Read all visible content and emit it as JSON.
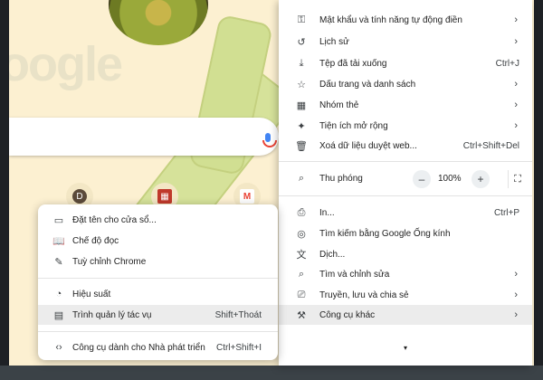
{
  "background": {
    "logo_text": "oogle",
    "shortcuts": [
      "D",
      "▦",
      "M"
    ]
  },
  "menu": {
    "items": [
      {
        "icon": "key-icon",
        "glyph": "⚿",
        "label": "Mật khẩu và tính năng tự động điền",
        "chevron": "›"
      },
      {
        "icon": "history-icon",
        "glyph": "↺",
        "label": "Lịch sử",
        "chevron": "›"
      },
      {
        "icon": "download-icon",
        "glyph": "⤓",
        "label": "Tệp đã tải xuống",
        "shortcut": "Ctrl+J"
      },
      {
        "icon": "star-icon",
        "glyph": "☆",
        "label": "Dấu trang và danh sách",
        "chevron": "›"
      },
      {
        "icon": "tab-groups-icon",
        "glyph": "▦",
        "label": "Nhóm thẻ",
        "chevron": "›"
      },
      {
        "icon": "extensions-icon",
        "glyph": "✦",
        "label": "Tiện ích mở rộng",
        "chevron": "›"
      },
      {
        "icon": "trash-icon",
        "glyph": "🗑",
        "label": "Xoá dữ liệu duyệt web...",
        "shortcut": "Ctrl+Shift+Del"
      }
    ],
    "zoom": {
      "icon": "zoom-icon",
      "glyph": "⌕",
      "label": "Thu phóng",
      "minus": "–",
      "value": "100%",
      "plus": "+",
      "fullscreen": "⛶"
    },
    "items2": [
      {
        "icon": "print-icon",
        "glyph": "⎙",
        "label": "In...",
        "shortcut": "Ctrl+P"
      },
      {
        "icon": "google-lens-icon",
        "glyph": "◎",
        "label": "Tìm kiếm bằng Google Ống kính"
      },
      {
        "icon": "translate-icon",
        "glyph": "文",
        "label": "Dịch..."
      },
      {
        "icon": "find-edit-icon",
        "glyph": "⌕",
        "label": "Tìm và chỉnh sửa",
        "chevron": "›"
      },
      {
        "icon": "cast-icon",
        "glyph": "⎚",
        "label": "Truyền, lưu và chia sẻ",
        "chevron": "›"
      },
      {
        "icon": "toolbox-icon",
        "glyph": "⚒",
        "label": "Công cụ khác",
        "chevron": "›"
      }
    ],
    "more_arrow": "▾"
  },
  "submenu": {
    "items": [
      {
        "icon": "window-name-icon",
        "glyph": "▭",
        "label": "Đặt tên cho cửa sổ..."
      },
      {
        "icon": "reading-mode-icon",
        "glyph": "📖",
        "label": "Chế độ đọc"
      },
      {
        "icon": "pencil-icon",
        "glyph": "✎",
        "label": "Tuỳ chỉnh Chrome"
      },
      {
        "icon": "performance-icon",
        "glyph": "◔",
        "label": "Hiệu suất"
      },
      {
        "icon": "task-manager-icon",
        "glyph": "▤",
        "label": "Trình quản lý tác vụ",
        "shortcut": "Shift+Thoát"
      },
      {
        "icon": "devtools-icon",
        "glyph": "‹›",
        "label": "Công cụ dành cho Nhà phát triển",
        "shortcut": "Ctrl+Shift+I"
      }
    ]
  }
}
